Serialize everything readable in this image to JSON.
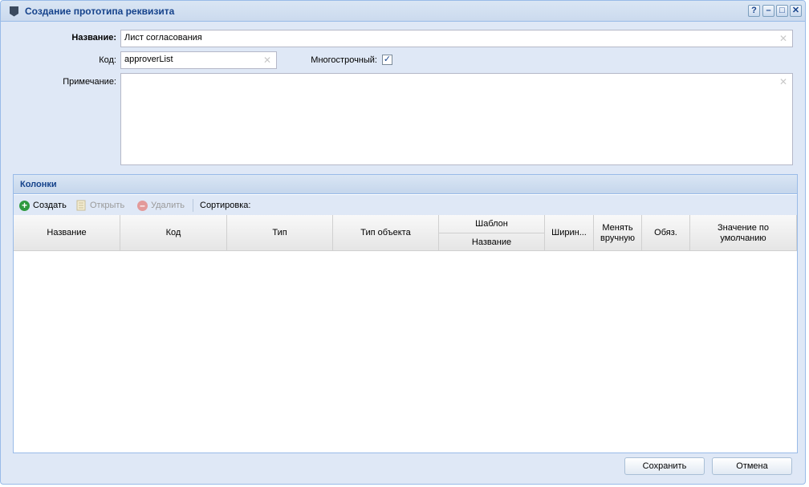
{
  "window": {
    "title": "Создание прототипа реквизита",
    "tools": {
      "help": "?",
      "minimize": "–",
      "maximize": "□",
      "close": "✕"
    }
  },
  "form": {
    "name_label": "Название:",
    "name_value": "Лист согласования",
    "code_label": "Код:",
    "code_value": "approverList",
    "multiline_label": "Многострочный:",
    "multiline_checked": true,
    "note_label": "Примечание:",
    "note_value": ""
  },
  "columns_panel": {
    "title": "Колонки",
    "toolbar": {
      "create": "Создать",
      "open": "Открыть",
      "delete": "Удалить",
      "sort": "Сортировка:"
    },
    "headers": {
      "name": "Название",
      "code": "Код",
      "type": "Тип",
      "object_type": "Тип объекта",
      "template": "Шаблон",
      "template_name": "Название",
      "width": "Ширин...",
      "manual_edit": "Менять вручную",
      "required": "Обяз.",
      "default_value": "Значение по умолчанию"
    },
    "rows": []
  },
  "buttons": {
    "save": "Сохранить",
    "cancel": "Отмена"
  },
  "colors": {
    "title_text": "#15428b",
    "panel_bg": "#dfe8f6",
    "border": "#99bbe8"
  }
}
